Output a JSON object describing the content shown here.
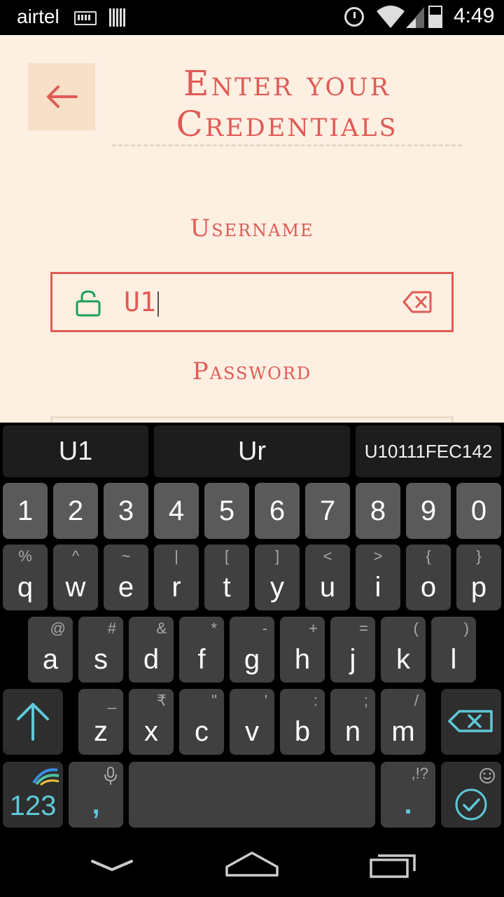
{
  "status_bar": {
    "carrier": "airtel",
    "time": "4:49"
  },
  "header": {
    "title_line1": "Enter your",
    "title_line2": "Credentials"
  },
  "form": {
    "username_label": "Username",
    "username_value": "U1",
    "password_label": "Password"
  },
  "keyboard": {
    "suggestions": [
      "U1",
      "Ur",
      "U10111FEC142"
    ],
    "number_row": [
      "1",
      "2",
      "3",
      "4",
      "5",
      "6",
      "7",
      "8",
      "9",
      "0"
    ],
    "row1": [
      {
        "key": "q",
        "alt": "%"
      },
      {
        "key": "w",
        "alt": "^"
      },
      {
        "key": "e",
        "alt": "~"
      },
      {
        "key": "r",
        "alt": "|"
      },
      {
        "key": "t",
        "alt": "["
      },
      {
        "key": "y",
        "alt": "]"
      },
      {
        "key": "u",
        "alt": "<"
      },
      {
        "key": "i",
        "alt": ">"
      },
      {
        "key": "o",
        "alt": "{"
      },
      {
        "key": "p",
        "alt": "}"
      }
    ],
    "row2": [
      {
        "key": "a",
        "alt": "@"
      },
      {
        "key": "s",
        "alt": "#"
      },
      {
        "key": "d",
        "alt": "&"
      },
      {
        "key": "f",
        "alt": "*"
      },
      {
        "key": "g",
        "alt": "-"
      },
      {
        "key": "h",
        "alt": "+"
      },
      {
        "key": "j",
        "alt": "="
      },
      {
        "key": "k",
        "alt": "("
      },
      {
        "key": "l",
        "alt": ")"
      }
    ],
    "row3": [
      {
        "key": "z",
        "alt": "_"
      },
      {
        "key": "x",
        "alt": "₹"
      },
      {
        "key": "c",
        "alt": "\""
      },
      {
        "key": "v",
        "alt": "'"
      },
      {
        "key": "b",
        "alt": ":"
      },
      {
        "key": "n",
        "alt": ";"
      },
      {
        "key": "m",
        "alt": "/"
      }
    ],
    "symbols_key": "123",
    "comma_key": ",",
    "period_key": ".",
    "period_alt": ",!?",
    "accent_color": "#5ec8d8"
  },
  "colors": {
    "brand": "#e05a55",
    "background": "#fdefe2",
    "lock_icon": "#1aa055"
  }
}
